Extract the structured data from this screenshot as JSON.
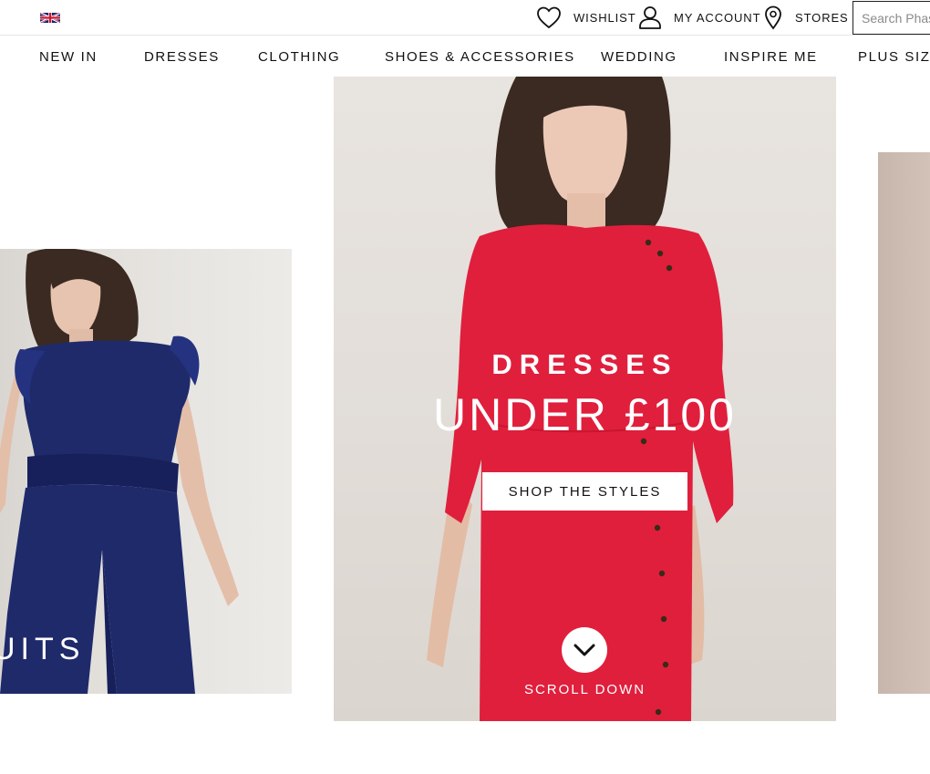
{
  "topbar": {
    "flag_icon": "uk-flag-icon",
    "wishlist_label": "WISHLIST",
    "account_label": "MY ACCOUNT",
    "stores_label": "STORES",
    "search_placeholder": "Search Phase Eight"
  },
  "nav": {
    "items": [
      {
        "label": "NEW IN"
      },
      {
        "label": "DRESSES"
      },
      {
        "label": "CLOTHING"
      },
      {
        "label": "SHOES & ACCESSORIES"
      },
      {
        "label": "WEDDING"
      },
      {
        "label": "INSPIRE ME"
      },
      {
        "label": "PLUS SIZE"
      }
    ]
  },
  "carousel": {
    "left_panel": {
      "caption": "UITS",
      "color": "#1f2a6b"
    },
    "center_panel": {
      "kicker": "DRESSES",
      "title": "UNDER £100",
      "cta_label": "SHOP THE STYLES",
      "scroll_label": "SCROLL DOWN",
      "dress_color": "#e01f3d"
    },
    "right_panel": {
      "color": "#c9b8ad"
    }
  },
  "colors": {
    "text": "#111111",
    "border": "#e6e6e6",
    "accent_red": "#e01f3d",
    "navy": "#1f2a6b"
  }
}
